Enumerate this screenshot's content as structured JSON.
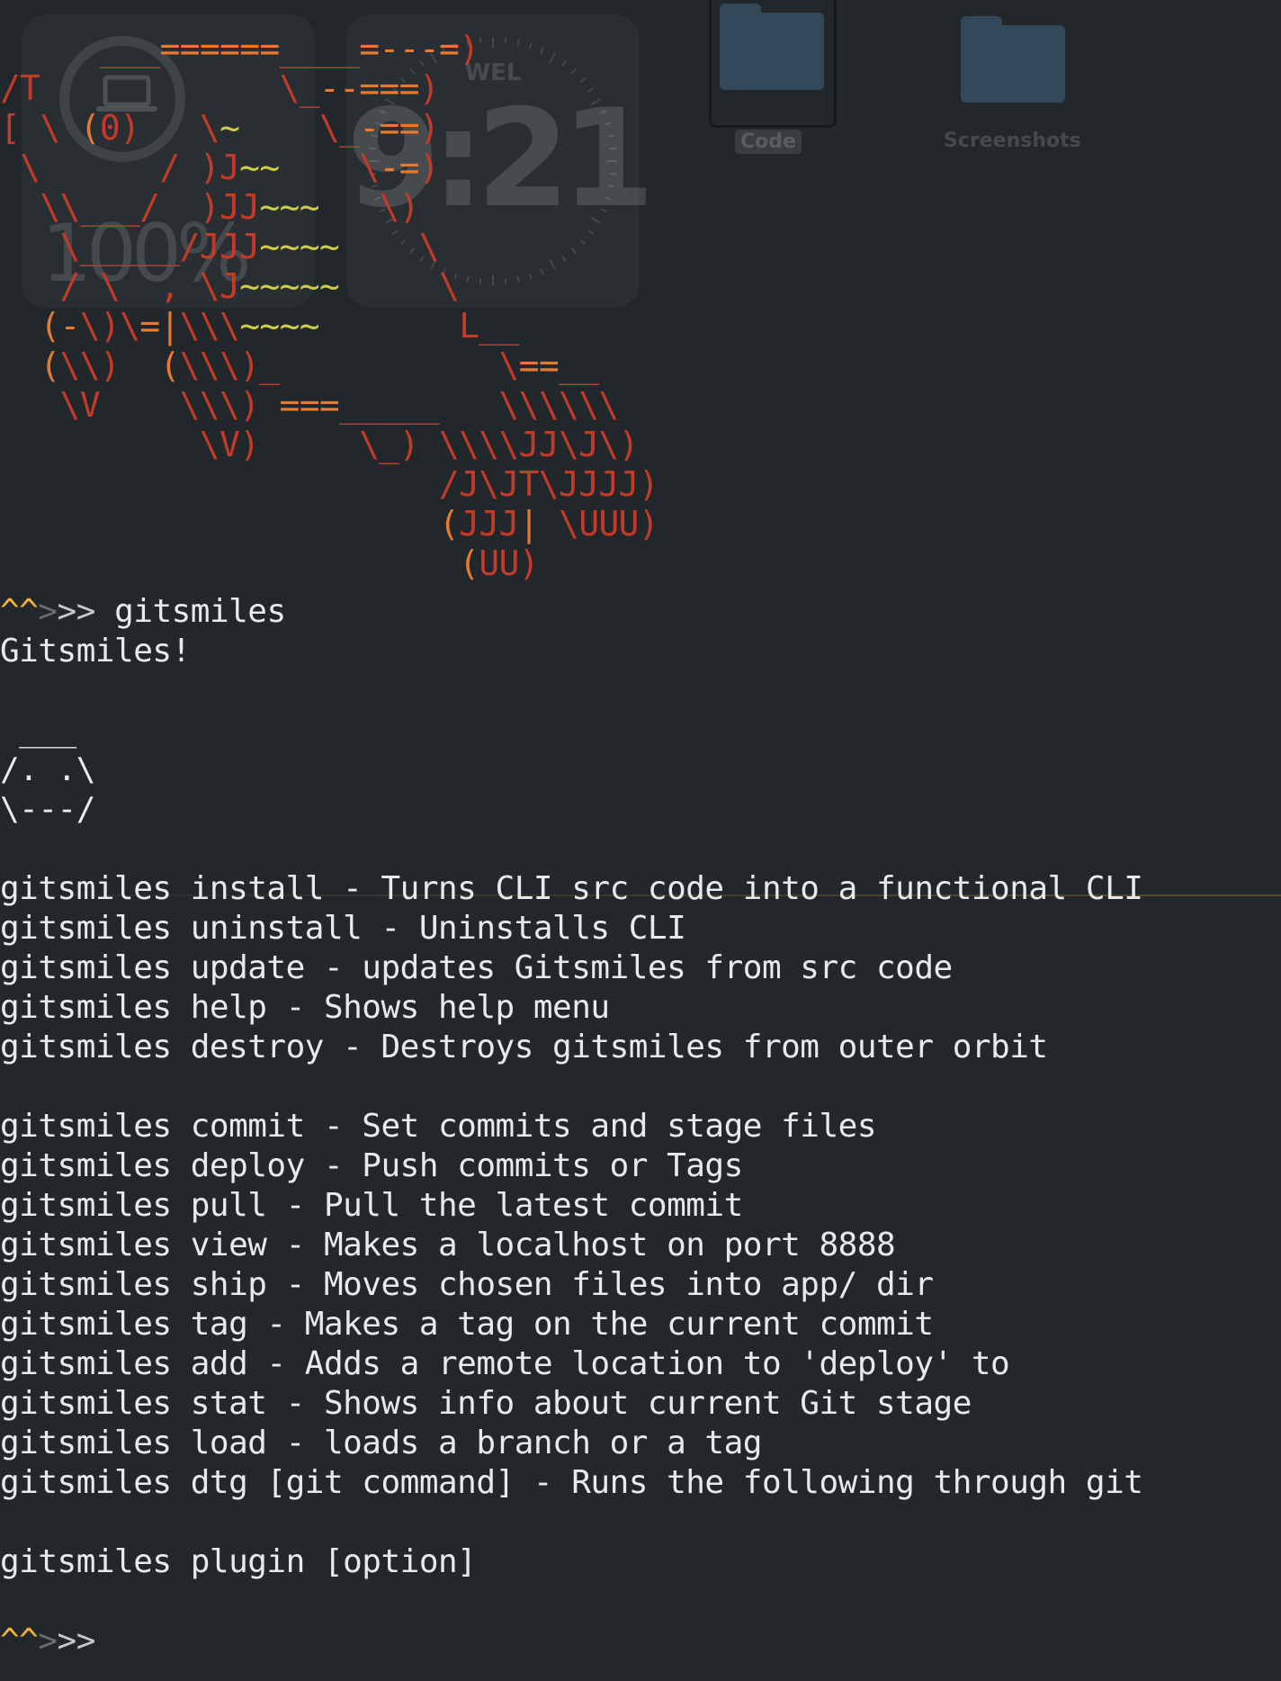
{
  "desktop": {
    "battery_widget": {
      "percent": "100%",
      "icon": "laptop-icon"
    },
    "clock_widget": {
      "day": "WEL",
      "time": "9:21"
    },
    "folders": [
      {
        "label": "Code",
        "icon": "folder-icon",
        "selected": true
      },
      {
        "label": "Screenshots",
        "icon": "folder-icon",
        "selected": false
      }
    ]
  },
  "terminal": {
    "theme": {
      "background": "#22272b",
      "text": "#e8e9ea",
      "prompt_accent": "#f2b233",
      "art_red": "#c43a28",
      "art_orange": "#e67a30",
      "art_yellow": "#cfcd45"
    },
    "ascii_art": [
      "     ___======____=---=)",
      "/T            \\_--===)",
      "[ \\ (0)   \\~    \\_-==)",
      " \\      / )J~~    \\-=)",
      "  \\\\___/  )JJ~~~   \\)",
      "   \\_____/JJJ~~~~    \\",
      "   / \\  , \\J~~~~~     \\",
      "  (-\\)\\=|\\\\\\~~~~       L__",
      "  (\\\\)  (\\\\\\)_           \\==__",
      "   \\V    \\\\\\) ===_____   \\\\\\\\\\\\",
      "          \\V)     \\_) \\\\\\\\JJ\\J\\)",
      "                      /J\\JT\\JJJJ)",
      "                      (JJJ| \\UUU)",
      "                       (UU)"
    ],
    "prompt_symbol_hat": "^^",
    "prompt_symbol_dim": ">",
    "prompt_symbol_arrow": ">>",
    "command": "gitsmiles",
    "title_line": "Gitsmiles!",
    "face_art": [
      " ___",
      "/. .\\",
      "\\---/"
    ],
    "help_group_1": [
      "gitsmiles install - Turns CLI src code into a functional CLI",
      "gitsmiles uninstall - Uninstalls CLI",
      "gitsmiles update - updates Gitsmiles from src code",
      "gitsmiles help - Shows help menu",
      "gitsmiles destroy - Destroys gitsmiles from outer orbit"
    ],
    "help_group_2": [
      "gitsmiles commit - Set commits and stage files",
      "gitsmiles deploy - Push commits or Tags",
      "gitsmiles pull - Pull the latest commit",
      "gitsmiles view - Makes a localhost on port 8888",
      "gitsmiles ship - Moves chosen files into app/ dir",
      "gitsmiles tag - Makes a tag on the current commit",
      "gitsmiles add - Adds a remote location to 'deploy' to",
      "gitsmiles stat - Shows info about current Git stage",
      "gitsmiles load - loads a branch or a tag",
      "gitsmiles dtg [git command] - Runs the following through git"
    ],
    "plugin_line": "gitsmiles plugin [option]"
  }
}
